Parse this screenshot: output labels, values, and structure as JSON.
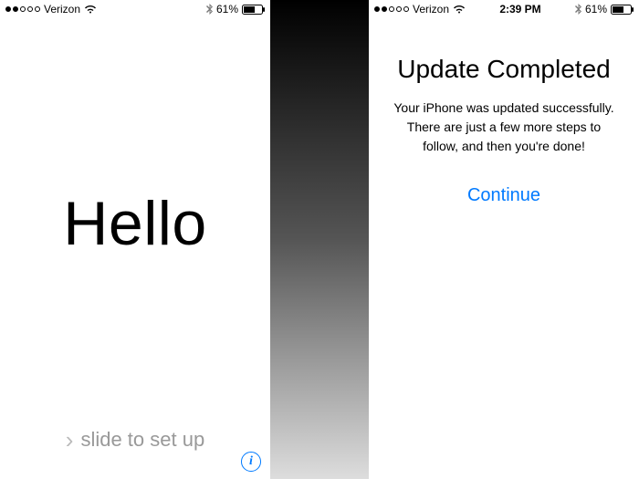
{
  "status": {
    "carrier": "Verizon",
    "time": "2:39 PM",
    "battery_pct": "61%",
    "signal_filled": 2,
    "signal_total": 5
  },
  "left_screen": {
    "greeting": "Hello",
    "slide_label": "slide to set up",
    "info_glyph": "i"
  },
  "right_screen": {
    "title": "Update Completed",
    "description": "Your iPhone was updated successfully. There are just a few more steps to follow, and then you're done!",
    "continue_label": "Continue"
  }
}
